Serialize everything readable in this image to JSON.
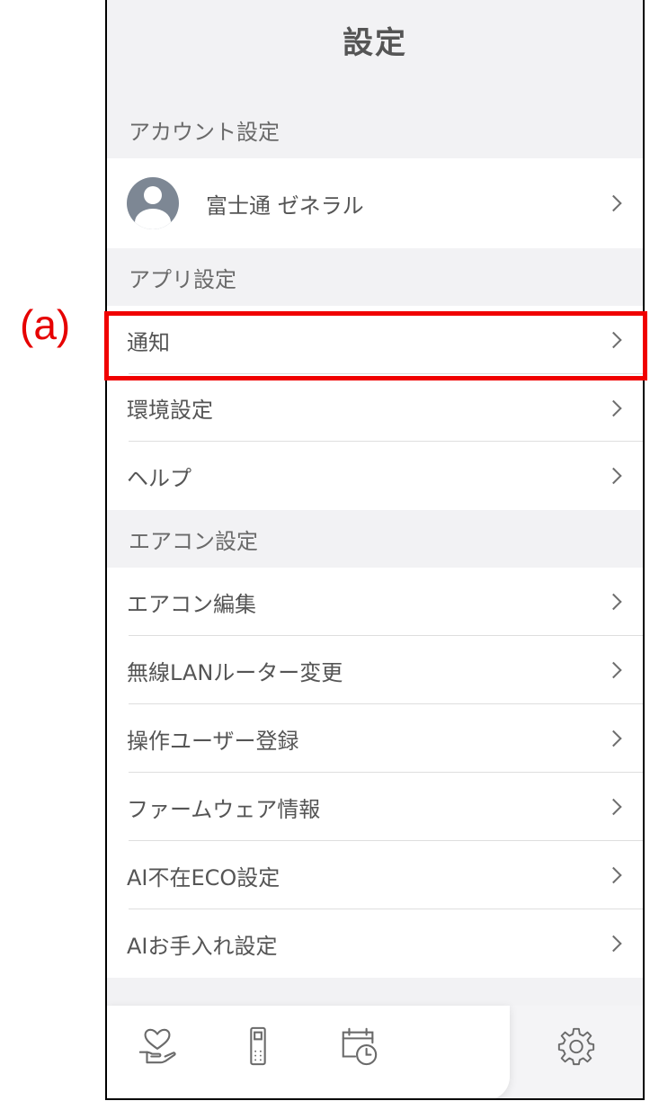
{
  "annotation": {
    "label": "(a)",
    "color": "#e60000"
  },
  "header": {
    "title": "設定"
  },
  "sections": {
    "account": {
      "title": "アカウント設定"
    },
    "app": {
      "title": "アプリ設定"
    },
    "aircon": {
      "title": "エアコン設定"
    }
  },
  "account_row": {
    "name": "富士通 ゼネラル",
    "icon": "user-avatar-icon"
  },
  "app_items": [
    {
      "label": "通知"
    },
    {
      "label": "環境設定"
    },
    {
      "label": "ヘルプ"
    }
  ],
  "aircon_items": [
    {
      "label": "エアコン編集"
    },
    {
      "label": "無線LANルーター変更"
    },
    {
      "label": "操作ユーザー登録"
    },
    {
      "label": "ファームウェア情報"
    },
    {
      "label": "AI不在ECO設定"
    },
    {
      "label": "AIお手入れ設定"
    }
  ],
  "tabs": [
    {
      "icon": "hand-heart-icon"
    },
    {
      "icon": "remote-control-icon"
    },
    {
      "icon": "calendar-clock-icon"
    },
    {
      "icon": "gear-icon",
      "selected": true
    }
  ],
  "colors": {
    "highlight": "#f00000",
    "background": "#f2f2f4"
  }
}
